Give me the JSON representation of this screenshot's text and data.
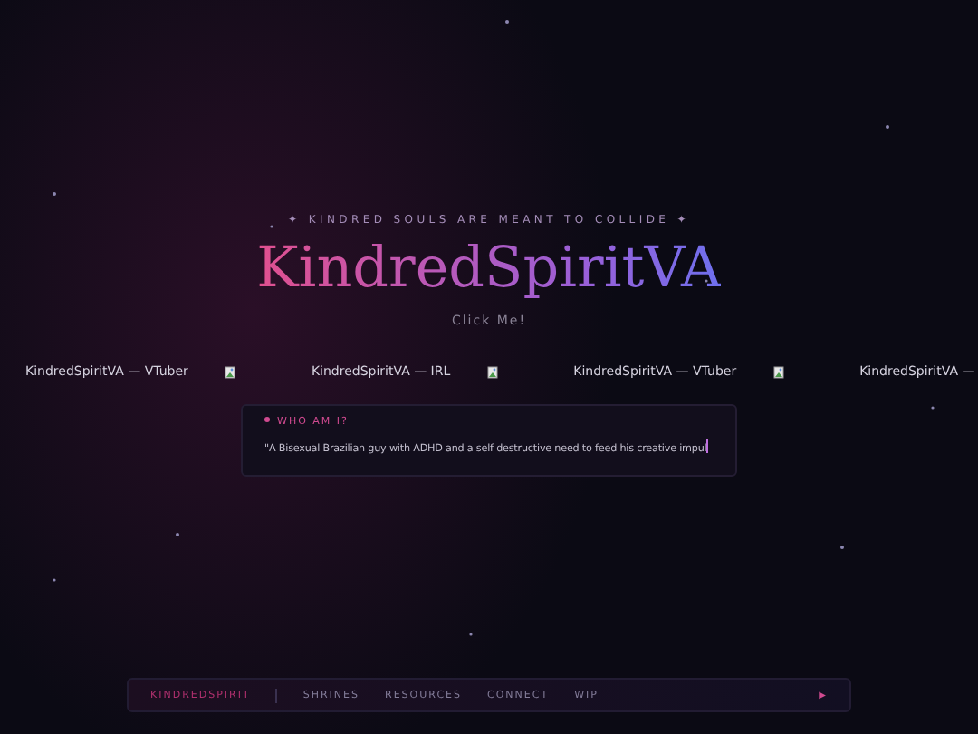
{
  "hero": {
    "tagline": "✦ KINDRED SOULS ARE MEANT TO COLLIDE ✦",
    "title": "KindredSpiritVA",
    "link": "Click Me!"
  },
  "marquee": [
    {
      "caption": "KindredSpiritVA — VTuber",
      "kind": "with-image"
    },
    {
      "caption": "KindredSpiritVA — IRL",
      "kind": "with-image"
    },
    {
      "caption": "KindredSpiritVA — VTuber",
      "kind": "with-image"
    },
    {
      "caption": "KindredSpiritVA —",
      "kind": "caption-only"
    }
  ],
  "about": {
    "heading": "WHO AM I?",
    "text": "\"A Bisexual Brazilian guy with ADHD and a self destructive need to feed his creative impul"
  },
  "nav": {
    "brand": "KINDREDSPIRIT",
    "links": [
      "SHRINES",
      "RESOURCES",
      "CONNECT",
      "WIP"
    ],
    "play": "▶"
  }
}
